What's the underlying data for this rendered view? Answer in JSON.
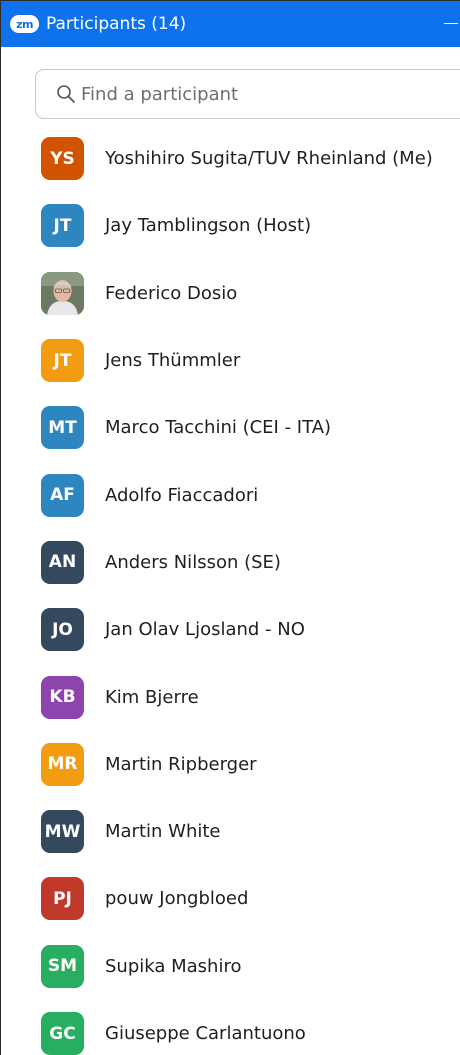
{
  "header": {
    "logo_text": "zm",
    "title": "Participants (14)"
  },
  "search": {
    "placeholder": "Find a participant"
  },
  "participants": [
    {
      "initials": "YS",
      "name": "Yoshihiro Sugita/TUV Rheinland (Me)",
      "color": "#d35400",
      "photo": false
    },
    {
      "initials": "JT",
      "name": "Jay Tamblingson (Host)",
      "color": "#2e86c1",
      "photo": false
    },
    {
      "initials": "",
      "name": "Federico Dosio",
      "color": "#8d9a86",
      "photo": true
    },
    {
      "initials": "JT",
      "name": "Jens Thümmler",
      "color": "#f39c12",
      "photo": false
    },
    {
      "initials": "MT",
      "name": "Marco Tacchini (CEI - ITA)",
      "color": "#2e86c1",
      "photo": false
    },
    {
      "initials": "AF",
      "name": "Adolfo Fiaccadori",
      "color": "#2e86c1",
      "photo": false
    },
    {
      "initials": "AN",
      "name": "Anders Nilsson (SE)",
      "color": "#34495e",
      "photo": false
    },
    {
      "initials": "JO",
      "name": "Jan Olav Ljosland - NO",
      "color": "#34495e",
      "photo": false
    },
    {
      "initials": "KB",
      "name": "Kim Bjerre",
      "color": "#8e44ad",
      "photo": false
    },
    {
      "initials": "MR",
      "name": "Martin Ripberger",
      "color": "#f39c12",
      "photo": false
    },
    {
      "initials": "MW",
      "name": "Martin White",
      "color": "#34495e",
      "photo": false
    },
    {
      "initials": "PJ",
      "name": "pouw Jongbloed",
      "color": "#c0392b",
      "photo": false
    },
    {
      "initials": "SM",
      "name": "Supika Mashiro",
      "color": "#27ae60",
      "photo": false
    },
    {
      "initials": "GC",
      "name": "Giuseppe Carlantuono",
      "color": "#27ae60",
      "photo": false
    }
  ]
}
